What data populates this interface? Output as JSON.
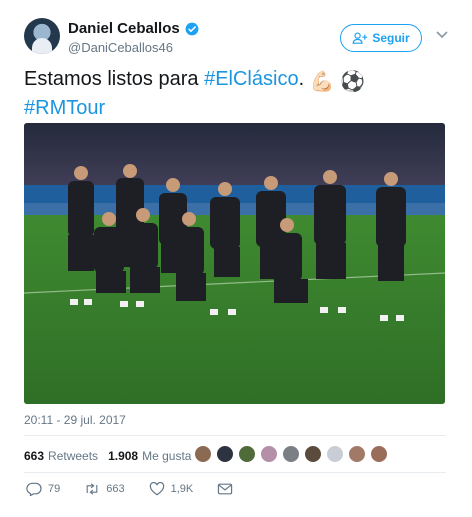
{
  "tweet": {
    "display_name": "Daniel Ceballos",
    "handle": "@DaniCeballos46",
    "follow_label": "Seguir",
    "text": "Estamos listos para ",
    "hashtag1": "#ElClásico",
    "text_after": ".",
    "hashtag2": "#RMTour",
    "emoji_muscle": "💪🏻",
    "emoji_ball": "⚽",
    "timestamp": "20:11 - 29 jul. 2017"
  },
  "stats": {
    "retweets_count": "663",
    "retweets_label": "Retweets",
    "likes_count": "1.908",
    "likes_label": "Me gusta"
  },
  "actions": {
    "reply_count": "79",
    "retweet_count": "663",
    "like_count": "1,9K"
  },
  "colors": {
    "accent": "#1da1f2",
    "hashtag": "#1b95e0",
    "muted": "#657786",
    "divider": "#e6ecf0"
  },
  "icons": [
    "verified-icon",
    "add-user-icon",
    "chevron-down-icon",
    "reply-icon",
    "retweet-icon",
    "heart-icon",
    "message-icon"
  ]
}
